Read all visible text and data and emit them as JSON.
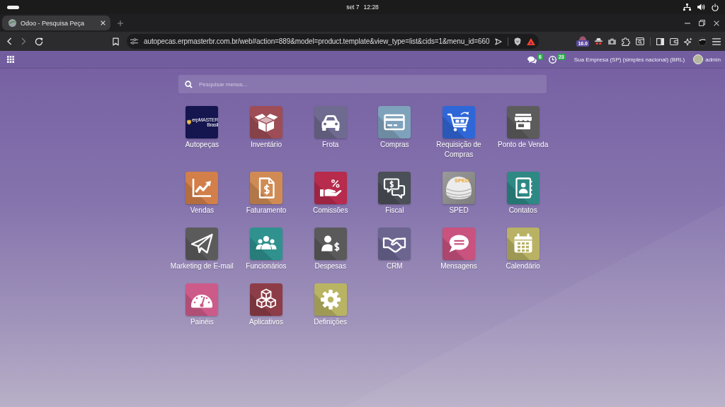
{
  "system_bar": {
    "date": "set 7",
    "time": "12:28"
  },
  "browser": {
    "tabs": [
      {
        "title": "Odoo - Pesquisa Peça",
        "selected": true
      }
    ],
    "back": {
      "disabled": false
    },
    "forward": {
      "disabled": true
    },
    "address": "autopecas.erpmasterbr.com.br/web#action=889&model=product.template&view_type=list&cids=1&menu_id=660",
    "extension_badge": "16.0"
  },
  "navbar": {
    "messages_count": "6",
    "activities_count": "23",
    "company": "Sua Empresa (SP) (simples nacional) (BRL)",
    "user": "admin"
  },
  "search": {
    "placeholder": "Pesquisar menus..."
  },
  "apps": [
    {
      "label": "Autopeças",
      "kind": "logo",
      "logo_text": [
        "erpMASTER",
        "Brasil"
      ]
    },
    {
      "label": "Inventário",
      "kind": "icon"
    },
    {
      "label": "Frota",
      "kind": "icon"
    },
    {
      "label": "Compras",
      "kind": "icon"
    },
    {
      "label": "Requisição de Compras",
      "kind": "icon"
    },
    {
      "label": "Ponto de Venda",
      "kind": "icon"
    },
    {
      "label": "Vendas",
      "kind": "icon"
    },
    {
      "label": "Faturamento",
      "kind": "icon"
    },
    {
      "label": "Comissões",
      "kind": "icon"
    },
    {
      "label": "Fiscal",
      "kind": "icon"
    },
    {
      "label": "SPED",
      "kind": "logo",
      "logo_text": [
        "SPED"
      ]
    },
    {
      "label": "Contatos",
      "kind": "icon"
    },
    {
      "label": "Marketing de E-mail",
      "kind": "icon"
    },
    {
      "label": "Funcionários",
      "kind": "icon"
    },
    {
      "label": "Despesas",
      "kind": "icon"
    },
    {
      "label": "CRM",
      "kind": "icon"
    },
    {
      "label": "Mensagens",
      "kind": "icon"
    },
    {
      "label": "Calendário",
      "kind": "icon"
    },
    {
      "label": "Painéis",
      "kind": "icon"
    },
    {
      "label": "Aplicativos",
      "kind": "icon"
    },
    {
      "label": "Definições",
      "kind": "icon"
    }
  ]
}
